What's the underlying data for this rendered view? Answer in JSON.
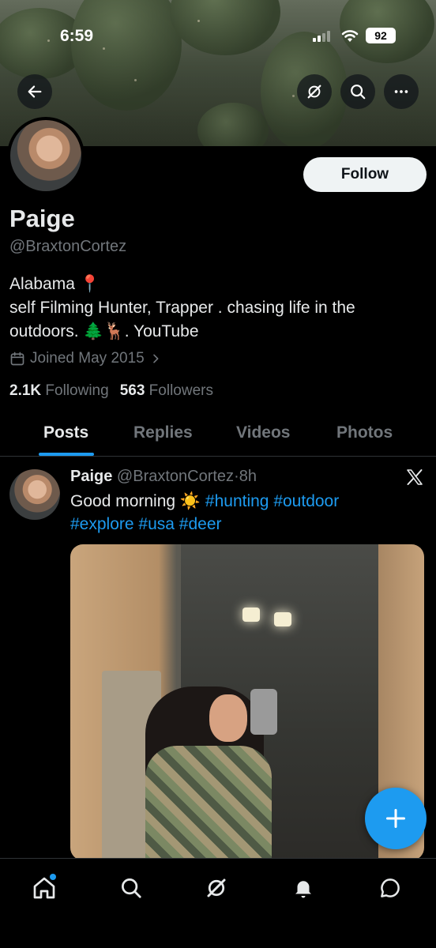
{
  "status_bar": {
    "time": "6:59",
    "battery": "92"
  },
  "profile": {
    "name": "Paige",
    "handle": "@BraxtonCortez",
    "follow_label": "Follow",
    "bio_line1": "Alabama 📍",
    "bio_line2": "self Filming Hunter, Trapper . chasing life in the",
    "bio_line3_prefix": "outdoors. 🌲🦌. ",
    "bio_link": "YouTube",
    "joined": "Joined May 2015",
    "following_count": "2.1K",
    "following_label": "Following",
    "followers_count": "563",
    "followers_label": "Followers"
  },
  "tabs": [
    {
      "label": "Posts",
      "active": true
    },
    {
      "label": "Replies",
      "active": false
    },
    {
      "label": "Videos",
      "active": false
    },
    {
      "label": "Photos",
      "active": false
    }
  ],
  "post": {
    "author": "Paige",
    "handle": "@BraxtonCortez",
    "separator": "·",
    "time": "8h",
    "text_prefix": "Good morning ☀️ ",
    "tags_line1": [
      "#hunting",
      "#outdoor"
    ],
    "tags_line2": [
      "#explore",
      "#usa",
      "#deer"
    ]
  },
  "icons": {
    "back": "arrow-left-icon",
    "grok": "grok-icon",
    "search": "search-icon",
    "more": "more-icon",
    "calendar": "calendar-icon",
    "x_logo": "x-logo-icon",
    "compose": "plus-icon",
    "home": "home-icon",
    "explore": "search-icon",
    "grok_nav": "grok-icon",
    "notifications": "bell-icon",
    "messages": "message-icon"
  },
  "colors": {
    "accent": "#1d9bf0",
    "background": "#000000",
    "secondary_text": "#71767b"
  }
}
